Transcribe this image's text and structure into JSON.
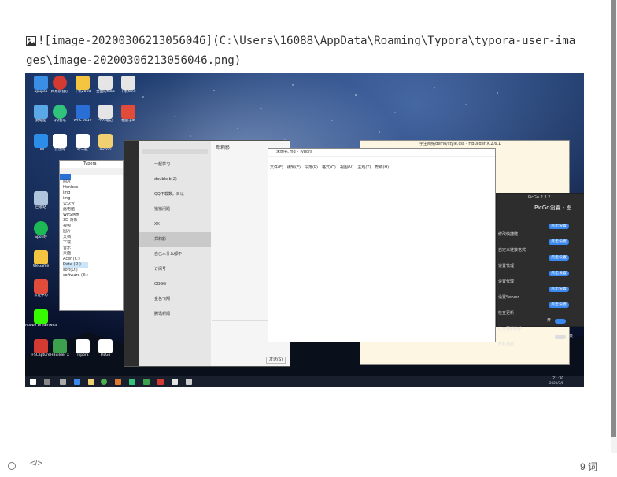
{
  "editor": {
    "markdown_line1": "![image-20200306213056046](C:\\Users\\16088\\AppData\\Roaming\\Typora\\typora-user-ima",
    "markdown_line2": "ges\\image-20200306213056046.png)"
  },
  "statusbar": {
    "source_code_label": "</>",
    "word_count": "9 词"
  },
  "screenshot": {
    "desktop_icons": [
      {
        "label": "upupoo",
        "color": "#3a8ee6"
      },
      {
        "label": "网易云音乐",
        "color": "#d33a31"
      },
      {
        "label": "千帆2018",
        "color": "#f5c542"
      },
      {
        "label": "全面的fbbb",
        "color": "#e5e5e5"
      },
      {
        "label": "千帆fand",
        "color": "#e5e5e5"
      },
      {
        "label": "此电脑",
        "color": "#5aa9e6"
      },
      {
        "label": "QQ音乐",
        "color": "#31c27c"
      },
      {
        "label": "WPS 2019",
        "color": "#2a6fd6"
      },
      {
        "label": "个人笔记",
        "color": "#e5e5e5"
      },
      {
        "label": "相册.pdf",
        "color": "#e04b3a"
      },
      {
        "label": "TIM",
        "color": "#2c8de8"
      },
      {
        "label": "云谱网",
        "color": "#ffffff"
      },
      {
        "label": "哔一航",
        "color": "#ffffff"
      },
      {
        "label": "mcroci",
        "color": "#f0d070"
      },
      {
        "label": "回收站",
        "color": "#b0c4de"
      },
      {
        "label": "Spotify",
        "color": "#1db954"
      },
      {
        "label": "WeGame",
        "color": "#f5c542"
      },
      {
        "label": "认证中心",
        "color": "#e04b3a"
      },
      {
        "label": "Adobe Dreamweaver",
        "color": "#35fa00"
      },
      {
        "label": "FSCapture",
        "color": "#d33a31"
      },
      {
        "label": "HBuilder X",
        "color": "#3ca04c"
      },
      {
        "label": "Typora",
        "color": "#ffffff"
      },
      {
        "label": "PicGo",
        "color": "#ffffff"
      }
    ],
    "wechat": {
      "chats": [
        "一起学习",
        "double b(2)",
        "QQ下载数。日以",
        "猪猪问题",
        "XX",
        "郑莉影",
        "自己人什么都不",
        "订阅号",
        "OBGG",
        "金色飞翔",
        "腾讯新闻"
      ],
      "title": "郑莉影",
      "send_label": "发送(S)"
    },
    "typora_window": {
      "title": "未命名.md - Typora",
      "menu": [
        "文件(F)",
        "编辑(E)",
        "段落(P)",
        "格式(O)",
        "视图(V)",
        "主题(T)",
        "帮助(H)"
      ]
    },
    "explorer": {
      "title": "Typora",
      "items": [
        "图片",
        "htmlcss",
        "img",
        "img",
        "公众号",
        "此电脑",
        "WPS网盘",
        "3D 对象",
        "视频",
        "图片",
        "文档",
        "下载",
        "音乐",
        "桌面",
        "Acer (C:)",
        "Data (D:)",
        "soft(D:)",
        "software (E:)"
      ]
    },
    "picgo": {
      "title": "PicGo设置 - 图",
      "version": "PicGo 2.3.2",
      "rows": [
        "修改快捷键",
        "自定义链接格式",
        "设置代理",
        "设置代理",
        "设置Server",
        "检查更新",
        "打开更新助手",
        "开机自启"
      ],
      "btn_label": "点击设置",
      "toggle_on": "开",
      "toggle_off": "关"
    },
    "hbuilder_title": "学生网络demo/style.css - HBuilder X 2.6.1",
    "taskbar": {
      "clock": "21:30",
      "date": "2020/3/6"
    }
  }
}
